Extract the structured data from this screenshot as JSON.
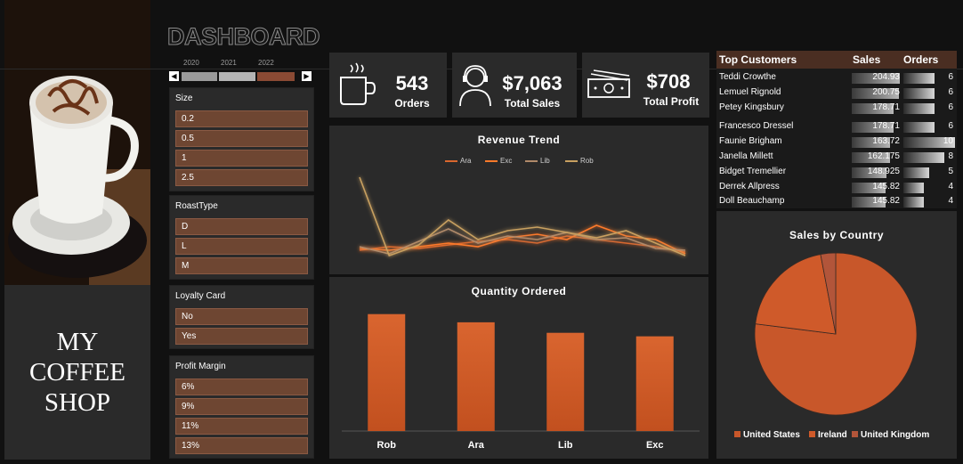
{
  "page_title": "DASHBOARD",
  "shop": {
    "line1": "MY",
    "line2": "COFFEE",
    "line3": "SHOP"
  },
  "timeline": {
    "years": [
      "2020",
      "2021",
      "2022"
    ],
    "left_arrow": "◀",
    "right_arrow": "▶"
  },
  "slicers": [
    {
      "title": "Size",
      "items": [
        "0.2",
        "0.5",
        "1",
        "2.5"
      ]
    },
    {
      "title": "RoastType",
      "items": [
        "D",
        "L",
        "M"
      ]
    },
    {
      "title": "Loyalty Card",
      "items": [
        "No",
        "Yes"
      ]
    },
    {
      "title": "Profit Margin",
      "items": [
        "6%",
        "9%",
        "11%",
        "13%"
      ]
    }
  ],
  "kpis": {
    "orders": {
      "value": "543",
      "label": "Orders",
      "icon": "coffee-cup-icon"
    },
    "sales": {
      "value": "$7,063",
      "label": "Total Sales",
      "icon": "customer-headset-icon"
    },
    "profit": {
      "value": "$708",
      "label": "Total Profit",
      "icon": "money-icon"
    }
  },
  "colors": {
    "accent": "#c8572a",
    "bar": "#d15a2b",
    "panel": "#2a2a2a",
    "slicer_item": "#6e4632",
    "ara": "#d9672e",
    "exc": "#ff7a2a",
    "lib": "#b08a6a",
    "rob": "#c8a060"
  },
  "top_customers": {
    "headers": {
      "name": "Top Customers",
      "sales": "Sales",
      "orders": "Orders"
    },
    "rows": [
      {
        "name": "Teddi Crowthe",
        "sales": "204.93",
        "sales_value": 204.93,
        "orders": "6",
        "orders_value": 6
      },
      {
        "name": "Lemuel Rignold",
        "sales": "200.75",
        "sales_value": 200.75,
        "orders": "6",
        "orders_value": 6
      },
      {
        "name": "Petey Kingsbury",
        "sales": "178.71",
        "sales_value": 178.71,
        "orders": "6",
        "orders_value": 6
      },
      {
        "name": "Francesco Dressel",
        "sales": "178.71",
        "sales_value": 178.71,
        "orders": "6",
        "orders_value": 6
      },
      {
        "name": "Faunie Brigham",
        "sales": "163.72",
        "sales_value": 163.72,
        "orders": "10",
        "orders_value": 10
      },
      {
        "name": "Janella Millett",
        "sales": "162.175",
        "sales_value": 162.175,
        "orders": "8",
        "orders_value": 8
      },
      {
        "name": "Bidget Tremellier",
        "sales": "148.925",
        "sales_value": 148.925,
        "orders": "5",
        "orders_value": 5
      },
      {
        "name": "Derrek Allpress",
        "sales": "145.82",
        "sales_value": 145.82,
        "orders": "4",
        "orders_value": 4
      },
      {
        "name": "Doll Beauchamp",
        "sales": "145.82",
        "sales_value": 145.82,
        "orders": "4",
        "orders_value": 4
      }
    ]
  },
  "chart_data": [
    {
      "type": "line",
      "title": "Revenue Trend",
      "x": [
        1,
        2,
        3,
        4,
        5,
        6,
        7,
        8,
        9,
        10,
        11,
        12
      ],
      "series": [
        {
          "name": "Ara",
          "values": [
            18,
            22,
            20,
            24,
            28,
            30,
            26,
            34,
            30,
            26,
            22,
            16
          ]
        },
        {
          "name": "Exc",
          "values": [
            20,
            18,
            22,
            26,
            22,
            32,
            36,
            30,
            46,
            34,
            30,
            14
          ]
        },
        {
          "name": "Lib",
          "values": [
            22,
            14,
            28,
            42,
            26,
            34,
            30,
            38,
            30,
            32,
            20,
            18
          ]
        },
        {
          "name": "Rob",
          "values": [
            100,
            12,
            24,
            52,
            30,
            40,
            44,
            38,
            32,
            40,
            26,
            12
          ]
        }
      ],
      "ylim": [
        0,
        110
      ],
      "legend": "top-center",
      "grid": false
    },
    {
      "type": "bar",
      "title": "Quantity Ordered",
      "categories": [
        "Rob",
        "Ara",
        "Lib",
        "Exc"
      ],
      "values": [
        100,
        93,
        84,
        81
      ],
      "ylim": [
        0,
        115
      ],
      "grid": false
    },
    {
      "type": "pie",
      "title": "Sales by Country",
      "categories": [
        "United States",
        "Ireland",
        "United Kingdom"
      ],
      "values": [
        77,
        20,
        3
      ],
      "colors": [
        "#c8572a",
        "#cf5a2a",
        "#b2553a"
      ],
      "legend": "bottom"
    }
  ]
}
